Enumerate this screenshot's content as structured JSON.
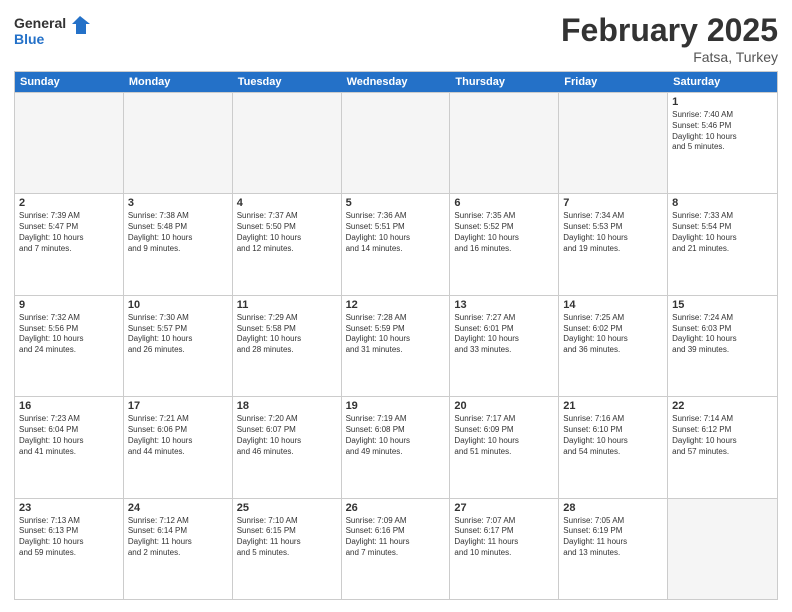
{
  "header": {
    "logo_general": "General",
    "logo_blue": "Blue",
    "month_title": "February 2025",
    "subtitle": "Fatsa, Turkey"
  },
  "weekdays": [
    "Sunday",
    "Monday",
    "Tuesday",
    "Wednesday",
    "Thursday",
    "Friday",
    "Saturday"
  ],
  "rows": [
    [
      {
        "day": "",
        "info": ""
      },
      {
        "day": "",
        "info": ""
      },
      {
        "day": "",
        "info": ""
      },
      {
        "day": "",
        "info": ""
      },
      {
        "day": "",
        "info": ""
      },
      {
        "day": "",
        "info": ""
      },
      {
        "day": "1",
        "info": "Sunrise: 7:40 AM\nSunset: 5:46 PM\nDaylight: 10 hours\nand 5 minutes."
      }
    ],
    [
      {
        "day": "2",
        "info": "Sunrise: 7:39 AM\nSunset: 5:47 PM\nDaylight: 10 hours\nand 7 minutes."
      },
      {
        "day": "3",
        "info": "Sunrise: 7:38 AM\nSunset: 5:48 PM\nDaylight: 10 hours\nand 9 minutes."
      },
      {
        "day": "4",
        "info": "Sunrise: 7:37 AM\nSunset: 5:50 PM\nDaylight: 10 hours\nand 12 minutes."
      },
      {
        "day": "5",
        "info": "Sunrise: 7:36 AM\nSunset: 5:51 PM\nDaylight: 10 hours\nand 14 minutes."
      },
      {
        "day": "6",
        "info": "Sunrise: 7:35 AM\nSunset: 5:52 PM\nDaylight: 10 hours\nand 16 minutes."
      },
      {
        "day": "7",
        "info": "Sunrise: 7:34 AM\nSunset: 5:53 PM\nDaylight: 10 hours\nand 19 minutes."
      },
      {
        "day": "8",
        "info": "Sunrise: 7:33 AM\nSunset: 5:54 PM\nDaylight: 10 hours\nand 21 minutes."
      }
    ],
    [
      {
        "day": "9",
        "info": "Sunrise: 7:32 AM\nSunset: 5:56 PM\nDaylight: 10 hours\nand 24 minutes."
      },
      {
        "day": "10",
        "info": "Sunrise: 7:30 AM\nSunset: 5:57 PM\nDaylight: 10 hours\nand 26 minutes."
      },
      {
        "day": "11",
        "info": "Sunrise: 7:29 AM\nSunset: 5:58 PM\nDaylight: 10 hours\nand 28 minutes."
      },
      {
        "day": "12",
        "info": "Sunrise: 7:28 AM\nSunset: 5:59 PM\nDaylight: 10 hours\nand 31 minutes."
      },
      {
        "day": "13",
        "info": "Sunrise: 7:27 AM\nSunset: 6:01 PM\nDaylight: 10 hours\nand 33 minutes."
      },
      {
        "day": "14",
        "info": "Sunrise: 7:25 AM\nSunset: 6:02 PM\nDaylight: 10 hours\nand 36 minutes."
      },
      {
        "day": "15",
        "info": "Sunrise: 7:24 AM\nSunset: 6:03 PM\nDaylight: 10 hours\nand 39 minutes."
      }
    ],
    [
      {
        "day": "16",
        "info": "Sunrise: 7:23 AM\nSunset: 6:04 PM\nDaylight: 10 hours\nand 41 minutes."
      },
      {
        "day": "17",
        "info": "Sunrise: 7:21 AM\nSunset: 6:06 PM\nDaylight: 10 hours\nand 44 minutes."
      },
      {
        "day": "18",
        "info": "Sunrise: 7:20 AM\nSunset: 6:07 PM\nDaylight: 10 hours\nand 46 minutes."
      },
      {
        "day": "19",
        "info": "Sunrise: 7:19 AM\nSunset: 6:08 PM\nDaylight: 10 hours\nand 49 minutes."
      },
      {
        "day": "20",
        "info": "Sunrise: 7:17 AM\nSunset: 6:09 PM\nDaylight: 10 hours\nand 51 minutes."
      },
      {
        "day": "21",
        "info": "Sunrise: 7:16 AM\nSunset: 6:10 PM\nDaylight: 10 hours\nand 54 minutes."
      },
      {
        "day": "22",
        "info": "Sunrise: 7:14 AM\nSunset: 6:12 PM\nDaylight: 10 hours\nand 57 minutes."
      }
    ],
    [
      {
        "day": "23",
        "info": "Sunrise: 7:13 AM\nSunset: 6:13 PM\nDaylight: 10 hours\nand 59 minutes."
      },
      {
        "day": "24",
        "info": "Sunrise: 7:12 AM\nSunset: 6:14 PM\nDaylight: 11 hours\nand 2 minutes."
      },
      {
        "day": "25",
        "info": "Sunrise: 7:10 AM\nSunset: 6:15 PM\nDaylight: 11 hours\nand 5 minutes."
      },
      {
        "day": "26",
        "info": "Sunrise: 7:09 AM\nSunset: 6:16 PM\nDaylight: 11 hours\nand 7 minutes."
      },
      {
        "day": "27",
        "info": "Sunrise: 7:07 AM\nSunset: 6:17 PM\nDaylight: 11 hours\nand 10 minutes."
      },
      {
        "day": "28",
        "info": "Sunrise: 7:05 AM\nSunset: 6:19 PM\nDaylight: 11 hours\nand 13 minutes."
      },
      {
        "day": "",
        "info": ""
      }
    ]
  ]
}
